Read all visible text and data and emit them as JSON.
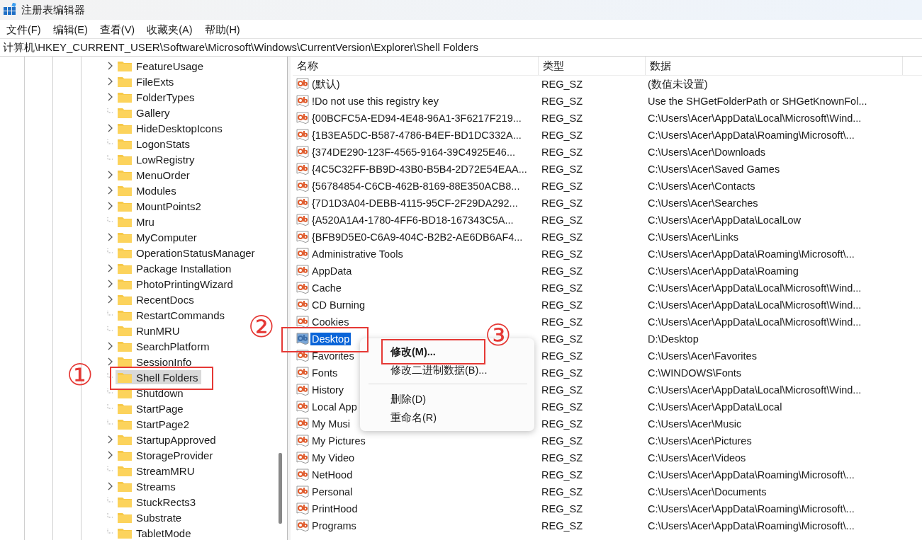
{
  "window": {
    "title": "注册表编辑器"
  },
  "menu": [
    "文件(F)",
    "编辑(E)",
    "查看(V)",
    "收藏夹(A)",
    "帮助(H)"
  ],
  "address": "计算机\\HKEY_CURRENT_USER\\Software\\Microsoft\\Windows\\CurrentVersion\\Explorer\\Shell Folders",
  "tree": {
    "items": [
      {
        "label": "FeatureUsage",
        "expandable": true,
        "selected": false
      },
      {
        "label": "FileExts",
        "expandable": true,
        "selected": false
      },
      {
        "label": "FolderTypes",
        "expandable": true,
        "selected": false
      },
      {
        "label": "Gallery",
        "expandable": false,
        "selected": false
      },
      {
        "label": "HideDesktopIcons",
        "expandable": true,
        "selected": false
      },
      {
        "label": "LogonStats",
        "expandable": false,
        "selected": false
      },
      {
        "label": "LowRegistry",
        "expandable": false,
        "selected": false
      },
      {
        "label": "MenuOrder",
        "expandable": true,
        "selected": false
      },
      {
        "label": "Modules",
        "expandable": true,
        "selected": false
      },
      {
        "label": "MountPoints2",
        "expandable": true,
        "selected": false
      },
      {
        "label": "Mru",
        "expandable": false,
        "selected": false
      },
      {
        "label": "MyComputer",
        "expandable": true,
        "selected": false
      },
      {
        "label": "OperationStatusManager",
        "expandable": false,
        "selected": false
      },
      {
        "label": "Package Installation",
        "expandable": true,
        "selected": false
      },
      {
        "label": "PhotoPrintingWizard",
        "expandable": true,
        "selected": false
      },
      {
        "label": "RecentDocs",
        "expandable": true,
        "selected": false
      },
      {
        "label": "RestartCommands",
        "expandable": false,
        "selected": false
      },
      {
        "label": "RunMRU",
        "expandable": false,
        "selected": false
      },
      {
        "label": "SearchPlatform",
        "expandable": true,
        "selected": false
      },
      {
        "label": "SessionInfo",
        "expandable": true,
        "selected": false
      },
      {
        "label": "Shell Folders",
        "expandable": false,
        "selected": true
      },
      {
        "label": "Shutdown",
        "expandable": false,
        "selected": false
      },
      {
        "label": "StartPage",
        "expandable": false,
        "selected": false
      },
      {
        "label": "StartPage2",
        "expandable": false,
        "selected": false
      },
      {
        "label": "StartupApproved",
        "expandable": true,
        "selected": false
      },
      {
        "label": "StorageProvider",
        "expandable": true,
        "selected": false
      },
      {
        "label": "StreamMRU",
        "expandable": false,
        "selected": false
      },
      {
        "label": "Streams",
        "expandable": true,
        "selected": false
      },
      {
        "label": "StuckRects3",
        "expandable": false,
        "selected": false
      },
      {
        "label": "Substrate",
        "expandable": false,
        "selected": false
      },
      {
        "label": "TabletMode",
        "expandable": false,
        "selected": false
      }
    ]
  },
  "list": {
    "columns": [
      "名称",
      "类型",
      "数据"
    ],
    "rows": [
      {
        "name": "(默认)",
        "type": "REG_SZ",
        "data": "(数值未设置)",
        "selected": false
      },
      {
        "name": "!Do not use this registry key",
        "type": "REG_SZ",
        "data": "Use the SHGetFolderPath or SHGetKnownFol...",
        "selected": false
      },
      {
        "name": "{00BCFC5A-ED94-4E48-96A1-3F6217F219...",
        "type": "REG_SZ",
        "data": "C:\\Users\\Acer\\AppData\\Local\\Microsoft\\Wind...",
        "selected": false
      },
      {
        "name": "{1B3EA5DC-B587-4786-B4EF-BD1DC332A...",
        "type": "REG_SZ",
        "data": "C:\\Users\\Acer\\AppData\\Roaming\\Microsoft\\...",
        "selected": false
      },
      {
        "name": "{374DE290-123F-4565-9164-39C4925E46...",
        "type": "REG_SZ",
        "data": "C:\\Users\\Acer\\Downloads",
        "selected": false
      },
      {
        "name": "{4C5C32FF-BB9D-43B0-B5B4-2D72E54EAA...",
        "type": "REG_SZ",
        "data": "C:\\Users\\Acer\\Saved Games",
        "selected": false
      },
      {
        "name": "{56784854-C6CB-462B-8169-88E350ACB8...",
        "type": "REG_SZ",
        "data": "C:\\Users\\Acer\\Contacts",
        "selected": false
      },
      {
        "name": "{7D1D3A04-DEBB-4115-95CF-2F29DA292...",
        "type": "REG_SZ",
        "data": "C:\\Users\\Acer\\Searches",
        "selected": false
      },
      {
        "name": "{A520A1A4-1780-4FF6-BD18-167343C5A...",
        "type": "REG_SZ",
        "data": "C:\\Users\\Acer\\AppData\\LocalLow",
        "selected": false
      },
      {
        "name": "{BFB9D5E0-C6A9-404C-B2B2-AE6DB6AF4...",
        "type": "REG_SZ",
        "data": "C:\\Users\\Acer\\Links",
        "selected": false
      },
      {
        "name": "Administrative Tools",
        "type": "REG_SZ",
        "data": "C:\\Users\\Acer\\AppData\\Roaming\\Microsoft\\...",
        "selected": false
      },
      {
        "name": "AppData",
        "type": "REG_SZ",
        "data": "C:\\Users\\Acer\\AppData\\Roaming",
        "selected": false
      },
      {
        "name": "Cache",
        "type": "REG_SZ",
        "data": "C:\\Users\\Acer\\AppData\\Local\\Microsoft\\Wind...",
        "selected": false
      },
      {
        "name": "CD Burning",
        "type": "REG_SZ",
        "data": "C:\\Users\\Acer\\AppData\\Local\\Microsoft\\Wind...",
        "selected": false
      },
      {
        "name": "Cookies",
        "type": "REG_SZ",
        "data": "C:\\Users\\Acer\\AppData\\Local\\Microsoft\\Wind...",
        "selected": false
      },
      {
        "name": "Desktop",
        "type": "REG_SZ",
        "data": "D:\\Desktop",
        "selected": true
      },
      {
        "name": "Favorites",
        "type": "REG_SZ",
        "data": "C:\\Users\\Acer\\Favorites",
        "selected": false
      },
      {
        "name": "Fonts",
        "type": "REG_SZ",
        "data": "C:\\WINDOWS\\Fonts",
        "selected": false
      },
      {
        "name": "History",
        "type": "REG_SZ",
        "data": "C:\\Users\\Acer\\AppData\\Local\\Microsoft\\Wind...",
        "selected": false
      },
      {
        "name": "Local App",
        "type": "REG_SZ",
        "data": "C:\\Users\\Acer\\AppData\\Local",
        "selected": false
      },
      {
        "name": "My Musi",
        "type": "REG_SZ",
        "data": "C:\\Users\\Acer\\Music",
        "selected": false
      },
      {
        "name": "My Pictures",
        "type": "REG_SZ",
        "data": "C:\\Users\\Acer\\Pictures",
        "selected": false
      },
      {
        "name": "My Video",
        "type": "REG_SZ",
        "data": "C:\\Users\\Acer\\Videos",
        "selected": false
      },
      {
        "name": "NetHood",
        "type": "REG_SZ",
        "data": "C:\\Users\\Acer\\AppData\\Roaming\\Microsoft\\...",
        "selected": false
      },
      {
        "name": "Personal",
        "type": "REG_SZ",
        "data": "C:\\Users\\Acer\\Documents",
        "selected": false
      },
      {
        "name": "PrintHood",
        "type": "REG_SZ",
        "data": "C:\\Users\\Acer\\AppData\\Roaming\\Microsoft\\...",
        "selected": false
      },
      {
        "name": "Programs",
        "type": "REG_SZ",
        "data": "C:\\Users\\Acer\\AppData\\Roaming\\Microsoft\\...",
        "selected": false
      }
    ]
  },
  "context_menu": {
    "items": [
      {
        "kind": "item",
        "label": "修改(M)...",
        "default": true
      },
      {
        "kind": "item",
        "label": "修改二进制数据(B)...",
        "default": false
      },
      {
        "kind": "separator"
      },
      {
        "kind": "item",
        "label": "删除(D)",
        "default": false
      },
      {
        "kind": "item",
        "label": "重命名(R)",
        "default": false
      }
    ]
  },
  "annotations": [
    {
      "label": "①"
    },
    {
      "label": "②"
    },
    {
      "label": "③"
    }
  ]
}
